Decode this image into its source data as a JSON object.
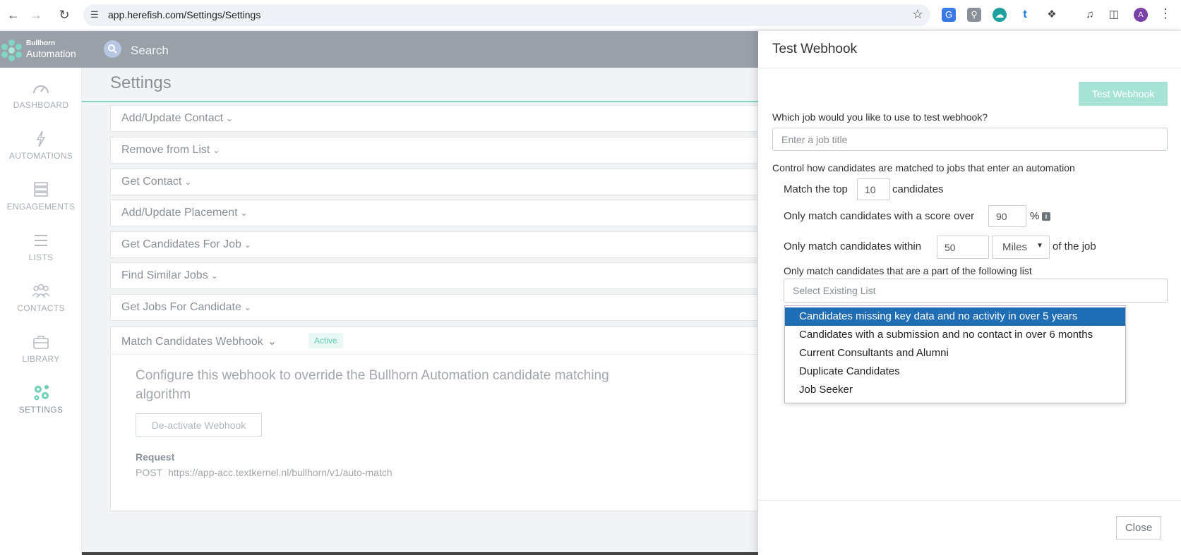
{
  "browser": {
    "url": "app.herefish.com/Settings/Settings",
    "avatar_letter": "A"
  },
  "app": {
    "brand_top": "Bullhorn",
    "brand_bottom": "Automation",
    "search_label": "Search",
    "accent_color": "#7fd6c3"
  },
  "sidebar": {
    "items": [
      {
        "label": "DASHBOARD",
        "icon": "gauge-icon"
      },
      {
        "label": "AUTOMATIONS",
        "icon": "lightning-icon"
      },
      {
        "label": "ENGAGEMENTS",
        "icon": "layers-icon"
      },
      {
        "label": "LISTS",
        "icon": "list-icon"
      },
      {
        "label": "CONTACTS",
        "icon": "people-icon"
      },
      {
        "label": "LIBRARY",
        "icon": "briefcase-icon"
      },
      {
        "label": "SETTINGS",
        "icon": "gears-icon"
      }
    ]
  },
  "main": {
    "title": "Settings",
    "sections": [
      "Add/Update Contact",
      "Remove from List",
      "Get Contact",
      "Add/Update Placement",
      "Get Candidates For Job",
      "Find Similar Jobs",
      "Get Jobs For Candidate"
    ],
    "open_section": {
      "label": "Match Candidates Webhook",
      "badge": "Active",
      "description": "Configure this webhook to override the Bullhorn Automation candidate matching algorithm",
      "deactivate_label": "De-activate Webhook",
      "request_label": "Request",
      "request_method": "POST",
      "request_url": "https://app-acc.textkernel.nl/bullhorn/v1/auto-match"
    }
  },
  "panel": {
    "title": "Test Webhook",
    "test_button": "Test Webhook",
    "job_question": "Which job would you like to use to test webhook?",
    "job_placeholder": "Enter a job title",
    "control_label": "Control how candidates are matched to jobs that enter an automation",
    "match_top_prefix": "Match the top",
    "match_top_value": "10",
    "match_top_suffix": "candidates",
    "score_prefix": "Only match candidates with a score over",
    "score_value": "90",
    "score_suffix": "%",
    "within_prefix": "Only match candidates within",
    "within_value": "50",
    "distance_unit": "Miles",
    "within_suffix": "of the job",
    "list_label": "Only match candidates that are a part of the following list",
    "list_placeholder": "Select Existing List",
    "list_options": [
      "Candidates missing key data and no activity in over 5 years",
      "Candidates with a submission and no contact in over 6 months",
      "Current Consultants and Alumni",
      "Duplicate Candidates",
      "Job Seeker"
    ],
    "close_label": "Close"
  }
}
